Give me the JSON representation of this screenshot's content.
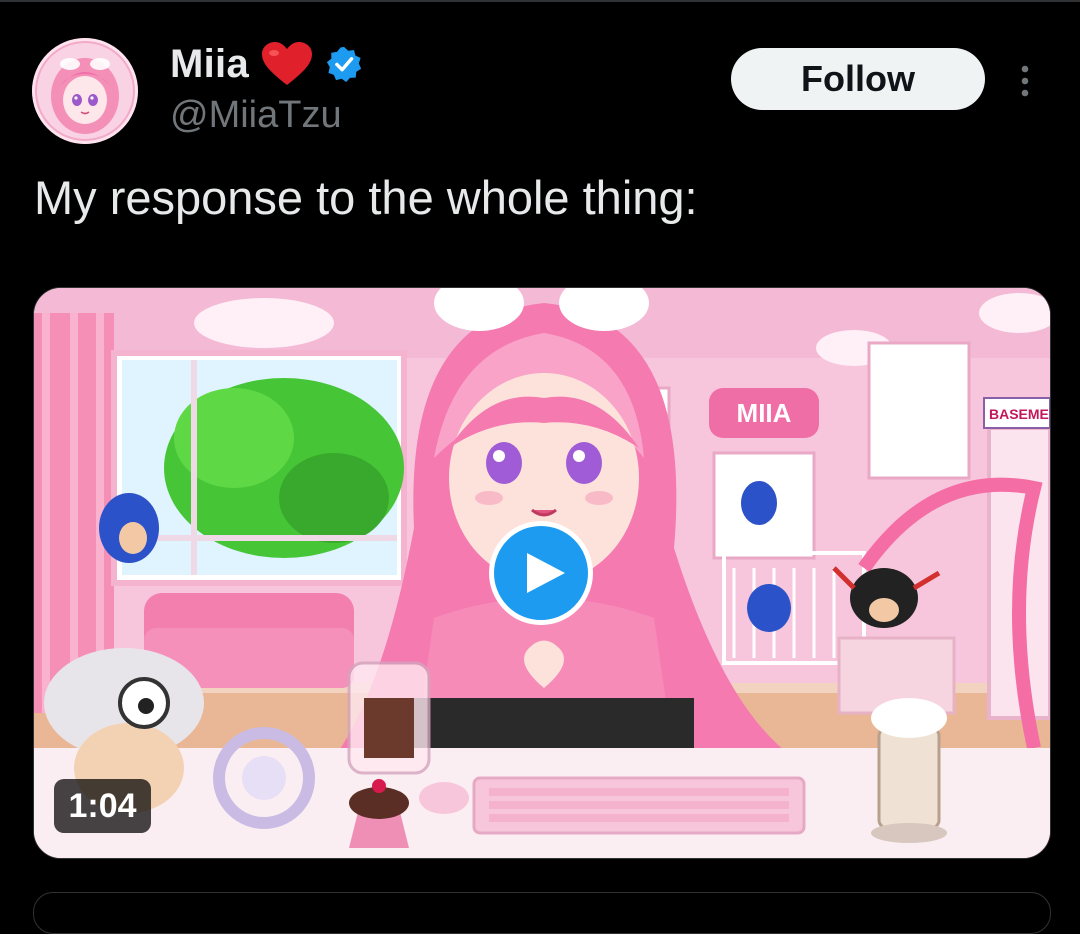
{
  "user": {
    "display_name": "Miia",
    "handle": "@MiiaTzu",
    "verified": true,
    "name_emoji": "heart-icon"
  },
  "actions": {
    "follow_label": "Follow",
    "more_icon": "more-options-icon"
  },
  "tweet": {
    "text": "My response to the whole thing:"
  },
  "media": {
    "type": "video",
    "duration": "1:04",
    "play_icon": "play-icon",
    "sign_text": "MIIA",
    "door_sign": "BASEMENT"
  },
  "colors": {
    "background": "#000000",
    "primary_text": "#e7e9ea",
    "secondary_text": "#71767b",
    "verified_blue": "#1d9bf0",
    "follow_bg": "#eff3f4",
    "heart_red": "#e0202a"
  }
}
